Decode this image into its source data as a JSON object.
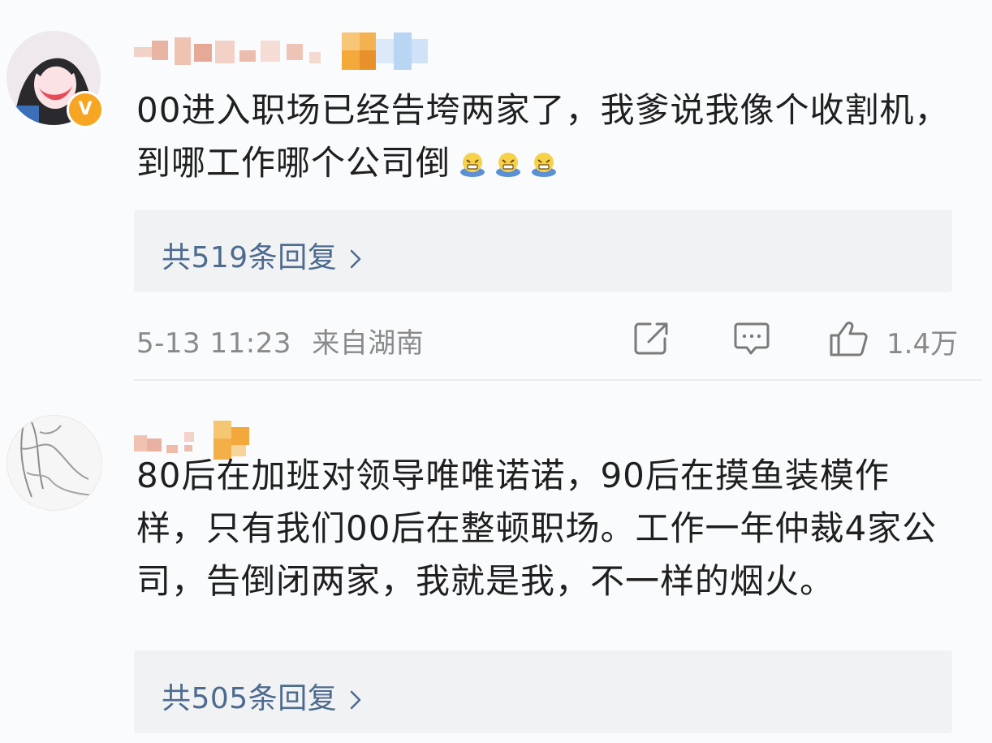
{
  "comments": [
    {
      "text": "00进入职场已经告垮两家了，我爹说我像个收割机，到哪工作哪个公司倒",
      "emoji_icon": "sweat-grimace-emoji",
      "emoji_count": 3,
      "verified_badge": "V",
      "replies_label": "共519条回复",
      "timestamp": "5-13 11:23",
      "location": "来自湖南",
      "like_count": "1.4万"
    },
    {
      "text": "80后在加班对领导唯唯诺诺，90后在摸鱼装模作样，只有我们00后在整顿职场。工作一年仲裁4家公司，告倒闭两家，我就是我，不一样的烟火。",
      "replies_label": "共505条回复"
    }
  ],
  "colors": {
    "link_blue": "#4d6b8f",
    "meta_gray": "#8a8a8a",
    "badge_orange": "#f6a623",
    "reply_bg": "#f1f2f4"
  }
}
